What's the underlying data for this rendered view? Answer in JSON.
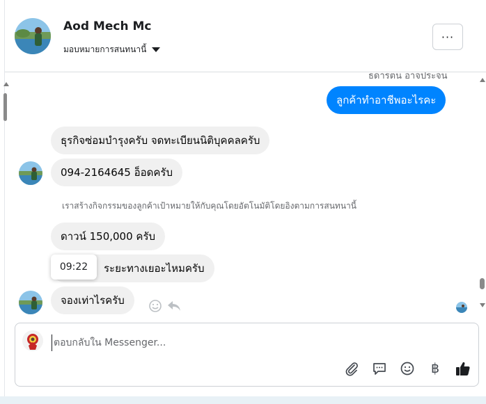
{
  "header": {
    "name": "Aod Mech Mc",
    "assign_label": "มอบหมายการสนทนานี้",
    "more_label": "···"
  },
  "thread": {
    "sender_label": "ธดารตน อาจประจน",
    "messages": [
      {
        "direction": "out",
        "text": "ลูกค้าทำอาชีพอะไรคะ"
      },
      {
        "direction": "in",
        "text": "ธุรกิจซ่อมบำรุงครับ จดทะเบียนนิติบุคคลครับ"
      },
      {
        "direction": "in",
        "text": "094-2164645 อ็อดครับ"
      },
      {
        "direction": "in",
        "text": "ดาวน์ 150,000 ครับ"
      },
      {
        "direction": "in",
        "text": "ระยะทางเยอะไหมครับ"
      },
      {
        "direction": "in",
        "text": "จองเท่าไรครับ"
      }
    ],
    "system_note": "เราสร้างกิจกรรมของลูกค้าเป้าหมายให้กับคุณโดยอัตโนมัติโดยอิงตามการสนทนานี้",
    "tooltip_time": "09:22"
  },
  "composer": {
    "placeholder": "ตอบกลับใน Messenger...",
    "value": "",
    "baht_symbol": "฿"
  },
  "colors": {
    "outgoing_bubble": "#0084ff",
    "incoming_bubble": "#f0f0f0",
    "like_icon": "#1c1e21"
  }
}
